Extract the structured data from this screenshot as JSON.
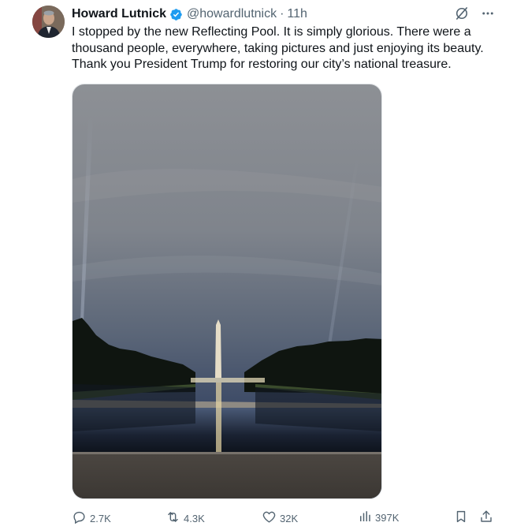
{
  "tweet": {
    "author_name": "Howard Lutnick",
    "handle": "@howardlutnick",
    "separator": "·",
    "time": "11h",
    "text_lines": [
      "I stopped by the new Reflecting Pool. It is simply glorious. There were a",
      "thousand people, everywhere, taking pictures and just  enjoying its beauty.",
      "Thank you President Trump for restoring our city’s national treasure."
    ]
  },
  "header_icons": [
    "grok-icon",
    "more-icon"
  ],
  "media": {
    "description_icon": "photo-reflecting-pool"
  },
  "actions": {
    "replies": "2.7K",
    "reposts": "4.3K",
    "likes": "32K",
    "views": "397K"
  },
  "colors": {
    "text": "#0f1419",
    "muted": "#536471",
    "verified": "#1d9bf0"
  }
}
